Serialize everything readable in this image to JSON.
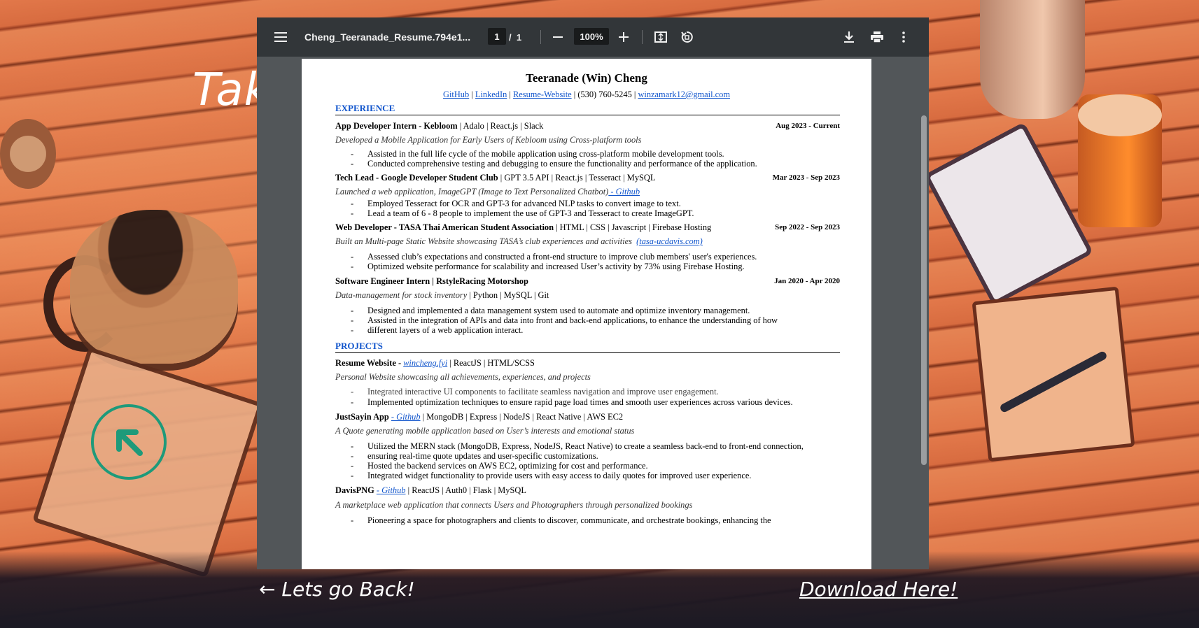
{
  "hero": {
    "text": "Tak"
  },
  "viewer": {
    "filename": "Cheng_Teeranade_Resume.794e1...",
    "page_current": "1",
    "page_sep": "/",
    "page_total": "1",
    "zoom": "100%",
    "icons": [
      "menu-icon",
      "zoom-out-icon",
      "zoom-in-icon",
      "fit-page-icon",
      "rotate-icon",
      "download-icon",
      "print-icon",
      "more-vert-icon"
    ]
  },
  "resume": {
    "name": "Teeranade (Win) Cheng",
    "contact": {
      "github": "GitHub",
      "linkedin": "LinkedIn",
      "website": "Resume-Website",
      "phone": "(530) 760-5245",
      "email": "winzamark12@gmail.com"
    },
    "experience_header": "EXPERIENCE",
    "jobs": [
      {
        "title": "App Developer Intern - Kebloom",
        "tech": " | Adalo | React.js | Slack",
        "date": "Aug 2023 - Current",
        "desc": "Developed a Mobile Application for Early Users of Kebloom using Cross-platform tools",
        "bullets": [
          "Assisted in the full life cycle of the mobile application using cross-platform mobile development tools.",
          "Conducted comprehensive testing and debugging to ensure the functionality and performance of the application."
        ]
      },
      {
        "title": "Tech Lead - Google Developer Student Club",
        "tech": " | GPT 3.5 API | React.js | Tesseract | MySQL",
        "date": "Mar 2023 - Sep 2023",
        "desc": "Launched a web application, ImageGPT (Image to Text Personalized Chatbot)",
        "desc_link": " - Github",
        "bullets": [
          "Employed Tesseract for OCR and GPT-3 for advanced NLP tasks to convert image to text.",
          "Lead a team of 6 - 8 people to implement the use of GPT-3 and Tesseract to create ImageGPT."
        ]
      },
      {
        "title": "Web Developer - TASA Thai American Student Association",
        "tech": " | HTML | CSS | Javascript | Firebase Hosting",
        "date": "Sep 2022 - Sep 2023",
        "desc": "Built an Multi-page Static Website showcasing TASA’s club experiences and activities",
        "desc_link": "(tasa-ucdavis.com)",
        "bullets": [
          "Assessed club’s expectations and constructed a front-end structure to improve club members' user's experiences.",
          "Optimized website performance for scalability and increased User’s activity by 73% using Firebase Hosting."
        ]
      },
      {
        "title": "Software Engineer Intern | RstyleRacing Motorshop",
        "tech": "",
        "date": "Jan 2020 - Apr 2020",
        "desc": "Data-management for stock inventory",
        "desc_tech": " | Python | MySQL | Git",
        "bullets": [
          "Designed and implemented a data management system used to automate and optimize inventory management.",
          "Assisted in the integration of APIs and data into front and back-end applications, to enhance the understanding of how",
          "different layers of a web application interact."
        ]
      }
    ],
    "projects_header": "PROJECTS",
    "projects": [
      {
        "title": "Resume Website - ",
        "link": "wincheng.fyi",
        "tech": " | ReactJS | HTML/SCSS",
        "desc": "Personal Website showcasing all achievements, experiences, and projects",
        "bullets": [
          "Integrated interactive UI components to facilitate seamless navigation and improve user engagement.",
          "Implemented optimization techniques to ensure rapid page load times and smooth user experiences across various devices."
        ]
      },
      {
        "title": "JustSayin App ",
        "link": "- Github",
        "tech": " | MongoDB | Express | NodeJS | React Native | AWS EC2",
        "desc": "A Quote generating mobile application based on User’s interests and emotional status",
        "bullets": [
          "Utilized the MERN stack (MongoDB, Express, NodeJS, React Native) to create a seamless back-end to front-end connection,",
          "ensuring real-time quote updates and user-specific customizations.",
          "Hosted the backend services on AWS EC2, optimizing for cost and performance.",
          "Integrated widget functionality to provide users with easy access to daily quotes for improved user experience."
        ]
      },
      {
        "title": "DavisPNG ",
        "link": "- Github",
        "tech": " | ReactJS | Auth0 | Flask | MySQL",
        "desc": "A marketplace web application that connects Users and Photographers through personalized bookings",
        "bullets": [
          "Pioneering a space for photographers and clients to discover, communicate, and orchestrate bookings, enhancing the"
        ]
      }
    ]
  },
  "footer": {
    "back": "Lets go Back!",
    "download": "Download Here!"
  },
  "colors": {
    "toolbar": "#323639",
    "viewer_bg": "#525659",
    "link": "#1155cc",
    "accent_teal": "#1e9a7a"
  }
}
